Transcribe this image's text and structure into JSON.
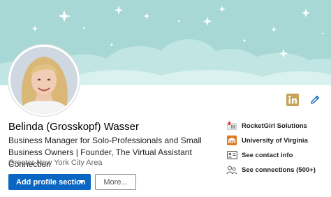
{
  "profile": {
    "name": "Belinda (Grosskopf) Wasser",
    "headline": "Business Manager for Solo-Professionals and Small Business Owners | Founder, The Virtual Assistant Connection",
    "location": "Greater New York City Area"
  },
  "actions": {
    "add_section_label": "Add profile section",
    "more_label": "More..."
  },
  "sidebar": {
    "items": [
      {
        "label": "RocketGirl Solutions",
        "icon": "company-logo-icon"
      },
      {
        "label": "University of Virginia",
        "icon": "school-logo-icon"
      },
      {
        "label": "See contact info",
        "icon": "contact-card-icon"
      },
      {
        "label": "See connections (500+)",
        "icon": "connections-icon"
      }
    ]
  },
  "header_icons": {
    "linkedin": "linkedin-icon",
    "edit": "pencil-icon"
  },
  "colors": {
    "banner": "#a7d8d5",
    "cloud": "#c9eae7",
    "accent": "#0a66c2",
    "linkedin_badge": "#c8a35a",
    "school": "#e07b20"
  }
}
